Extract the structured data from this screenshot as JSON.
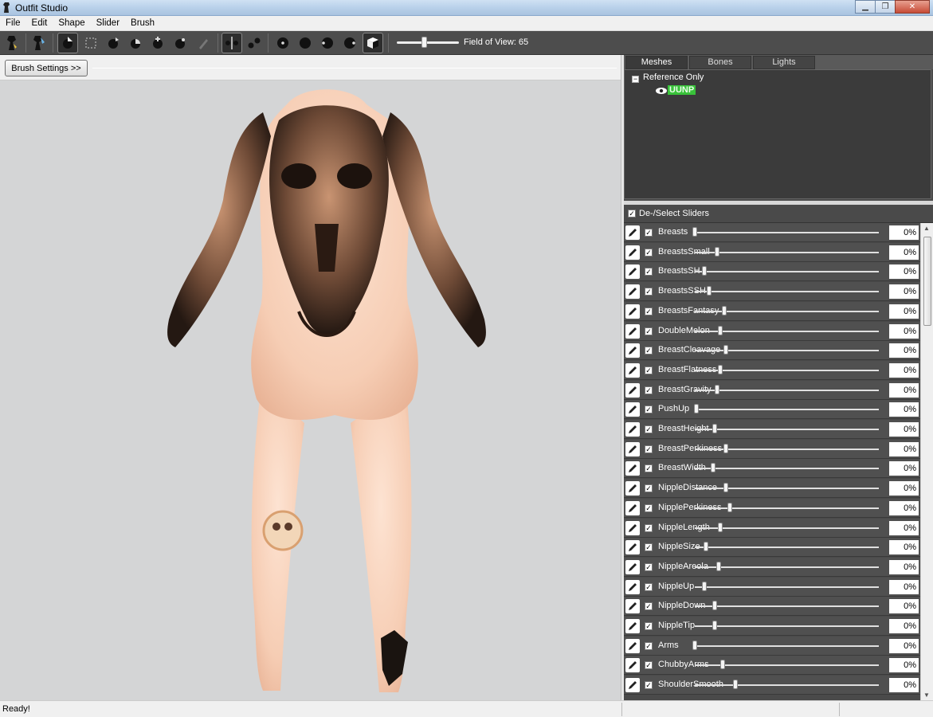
{
  "window": {
    "title": "Outfit Studio"
  },
  "menu": [
    "File",
    "Edit",
    "Shape",
    "Slider",
    "Brush"
  ],
  "toolbar": {
    "fov_label": "Field of View: 65",
    "fov_value": 65,
    "tools": [
      "select-brush-icon",
      "mask-brush-icon",
      "inflate-brush-icon",
      "deflate-brush-icon",
      "move-brush-icon",
      "smooth-brush-icon",
      "weight-brush-icon",
      "color-brush-icon",
      "mirror-icon",
      "connected-icon",
      "view-front-icon",
      "view-back-icon",
      "view-left-icon",
      "view-right-icon",
      "perspective-icon"
    ]
  },
  "brush_settings_label": "Brush Settings >>",
  "tabs": [
    "Meshes",
    "Bones",
    "Lights"
  ],
  "tree": {
    "root": "Reference Only",
    "mesh": "UUNP",
    "toggle": "−"
  },
  "sliders_header": "De-/Select Sliders",
  "sliders": [
    {
      "name": "Breasts",
      "value": "0%",
      "pos": 0.0
    },
    {
      "name": "BreastsSmall",
      "value": "0%",
      "pos": 0.12
    },
    {
      "name": "BreastsSH",
      "value": "0%",
      "pos": 0.05
    },
    {
      "name": "BreastsSSH",
      "value": "0%",
      "pos": 0.08
    },
    {
      "name": "BreastsFantasy",
      "value": "0%",
      "pos": 0.16
    },
    {
      "name": "DoubleMelon",
      "value": "0%",
      "pos": 0.14
    },
    {
      "name": "BreastCleavage",
      "value": "0%",
      "pos": 0.17
    },
    {
      "name": "BreastFlatness",
      "value": "0%",
      "pos": 0.14
    },
    {
      "name": "BreastGravity",
      "value": "0%",
      "pos": 0.12
    },
    {
      "name": "PushUp",
      "value": "0%",
      "pos": 0.01
    },
    {
      "name": "BreastHeight",
      "value": "0%",
      "pos": 0.11
    },
    {
      "name": "BreastPerkiness",
      "value": "0%",
      "pos": 0.17
    },
    {
      "name": "BreastWidth",
      "value": "0%",
      "pos": 0.1
    },
    {
      "name": "NippleDistance",
      "value": "0%",
      "pos": 0.17
    },
    {
      "name": "NipplePerkiness",
      "value": "0%",
      "pos": 0.19
    },
    {
      "name": "NippleLength",
      "value": "0%",
      "pos": 0.14
    },
    {
      "name": "NippleSize",
      "value": "0%",
      "pos": 0.06
    },
    {
      "name": "NippleAreola",
      "value": "0%",
      "pos": 0.13
    },
    {
      "name": "NippleUp",
      "value": "0%",
      "pos": 0.05
    },
    {
      "name": "NippleDown",
      "value": "0%",
      "pos": 0.11
    },
    {
      "name": "NippleTip",
      "value": "0%",
      "pos": 0.11
    },
    {
      "name": "Arms",
      "value": "0%",
      "pos": 0.0
    },
    {
      "name": "ChubbyArms",
      "value": "0%",
      "pos": 0.15
    },
    {
      "name": "ShoulderSmooth",
      "value": "0%",
      "pos": 0.22
    }
  ],
  "status": "Ready!",
  "colors": {
    "toolbar_bg": "#4d4d4d",
    "panel_bg": "#4a4a4a",
    "viewport_bg": "#d4d5d6",
    "mesh_badge": "#39c23a"
  }
}
